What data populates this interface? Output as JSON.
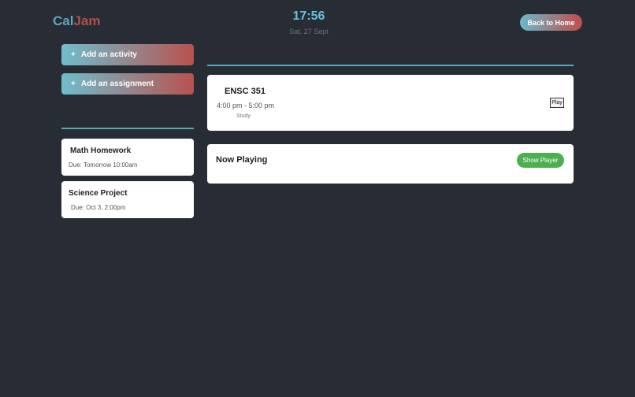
{
  "header": {
    "logo_part1": "Cal",
    "logo_part2": "Jam",
    "time": "17:56",
    "date": "Sat, 27 Sept",
    "home_button": "Back to Home"
  },
  "actions": {
    "add_activity": {
      "icon": "+",
      "label": "Add an activity"
    },
    "add_assignment": {
      "icon": "+",
      "label": "Add an assignment"
    }
  },
  "assignments": [
    {
      "title": "Math Homework",
      "due": "Due: Tomorrow 10:00am"
    },
    {
      "title": "Science Project",
      "due": "Due: Oct 3, 2:00pm"
    }
  ],
  "event": {
    "title": "ENSC 351",
    "time": "4:00 pm - 5:00 pm",
    "type": "Study",
    "play_label": "Play"
  },
  "now_playing": {
    "title": "Now Playing",
    "show_player_label": "Show Player"
  },
  "colors": {
    "background": "#282c34",
    "accent": "#61c3da",
    "brand_red": "#b3504a",
    "show_player_green": "#4caf50"
  }
}
